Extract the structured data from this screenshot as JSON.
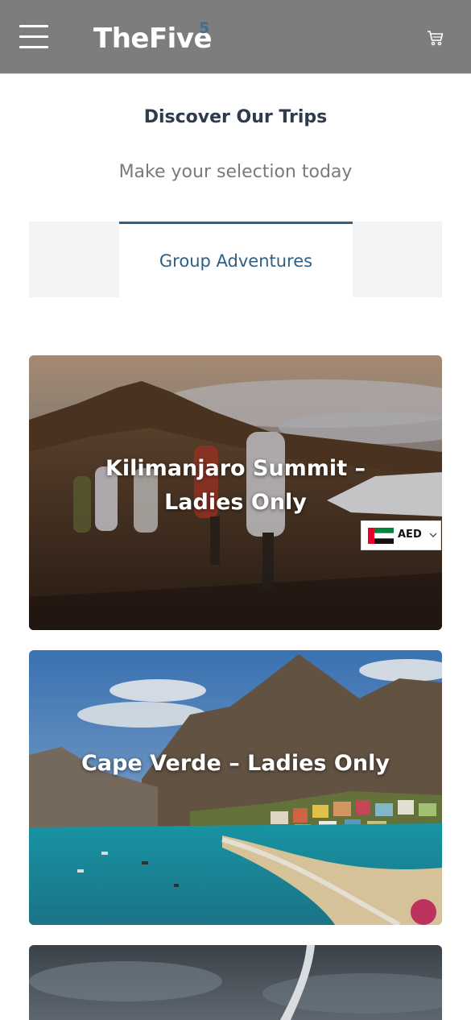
{
  "header": {
    "logo_text": "TheFive",
    "logo_superscript": "5",
    "menu_icon": "hamburger-menu-icon",
    "cart_icon": "cart-icon",
    "background": "#7d7d7d"
  },
  "intro": {
    "title": "Discover Our Trips",
    "subtitle": "Make your selection today"
  },
  "tabs": {
    "active_label": "Group Adventures",
    "accent": "#2f5f82"
  },
  "trips": [
    {
      "title": "Kilimanjaro Summit – Ladies Only",
      "line1": "Kilimanjaro Summit –",
      "line2": "Ladies Only"
    },
    {
      "title": "Cape Verde – Ladies Only"
    },
    {
      "title": ""
    }
  ],
  "currency": {
    "code": "AED",
    "flag_icon": "uae-flag-icon",
    "dropdown_icon": "chevron-down-icon"
  }
}
